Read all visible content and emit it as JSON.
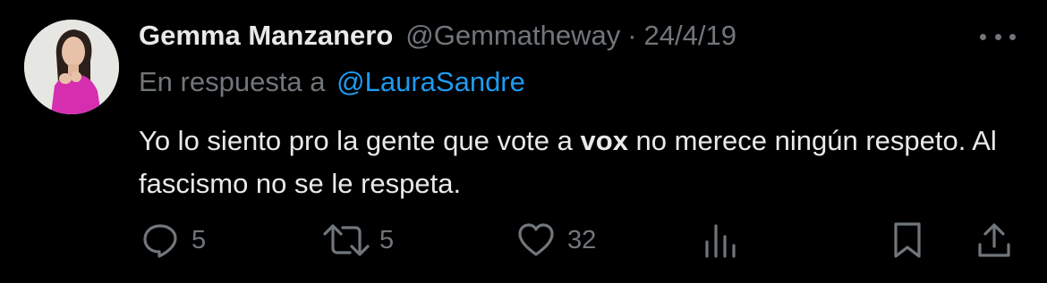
{
  "tweet": {
    "author_name": "Gemma Manzanero",
    "handle": "@Gemmatheway",
    "separator": "·",
    "date": "24/4/19",
    "reply_prefix": "En respuesta a",
    "reply_to": "@LauraSandre",
    "text_part1": "Yo lo siento pro la gente que vote a ",
    "text_bold": "vox",
    "text_part2": " no merece ningún respeto. Al fascismo no se le respeta."
  },
  "actions": {
    "reply_count": "5",
    "retweet_count": "5",
    "like_count": "32"
  },
  "colors": {
    "background": "#000000",
    "text": "#e7e9ea",
    "muted": "#71767b",
    "accent": "#1d9bf0"
  },
  "icons": [
    "more-icon",
    "reply-icon",
    "retweet-icon",
    "like-icon",
    "analytics-icon",
    "bookmark-icon",
    "share-icon"
  ]
}
